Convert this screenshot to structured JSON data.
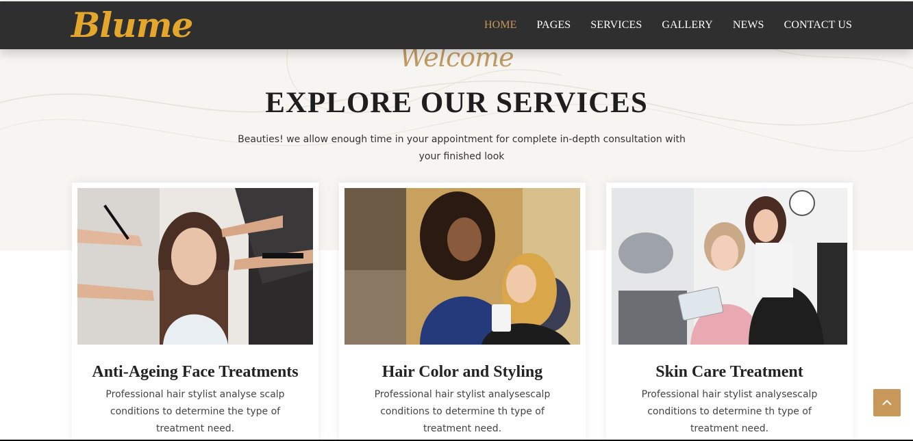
{
  "brand": {
    "logo_text": "Blume"
  },
  "nav": {
    "items": [
      {
        "label": "HOME",
        "active": true
      },
      {
        "label": "PAGES",
        "active": false
      },
      {
        "label": "SERVICES",
        "active": false
      },
      {
        "label": "GALLERY",
        "active": false
      },
      {
        "label": "NEWS",
        "active": false
      },
      {
        "label": "CONTACT US",
        "active": false
      }
    ]
  },
  "section": {
    "script_label": "Welcome",
    "title": "EXPLORE OUR SERVICES",
    "description": "Beauties! we allow enough time in your appointment for complete in-depth consultation with your finished look"
  },
  "services": [
    {
      "title": "Anti-Ageing Face Treatments",
      "text": "Professional hair stylist analyse scalp conditions to determine the type of treatment need."
    },
    {
      "title": "Hair Color and Styling",
      "text": "Professional hair stylist analysescalp conditions to determine th type of treatment need."
    },
    {
      "title": "Skin Care Treatment",
      "text": "Professional hair stylist analysescalp conditions to determine th type of treatment need."
    }
  ],
  "colors": {
    "navbar": "#2f2f2f",
    "logo": "#e2a72c",
    "accent": "#c8975a",
    "hero_bg": "#f7f5f1"
  },
  "icons": {
    "scroll_top": "chevron-up-icon"
  }
}
